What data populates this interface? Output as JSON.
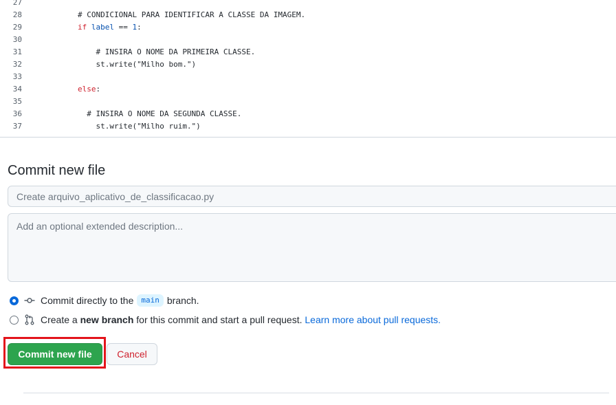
{
  "code": {
    "lines": [
      {
        "num": "27",
        "tokens": []
      },
      {
        "num": "28",
        "tokens": [
          {
            "t": "        ",
            "c": ""
          },
          {
            "t": "# CONDICIONAL PARA IDENTIFICAR A CLASSE DA IMAGEM.",
            "c": ""
          }
        ]
      },
      {
        "num": "29",
        "tokens": [
          {
            "t": "        ",
            "c": ""
          },
          {
            "t": "if",
            "c": "kw"
          },
          {
            "t": " ",
            "c": ""
          },
          {
            "t": "label",
            "c": "var"
          },
          {
            "t": " == ",
            "c": ""
          },
          {
            "t": "1",
            "c": "num"
          },
          {
            "t": ":",
            "c": ""
          }
        ]
      },
      {
        "num": "30",
        "tokens": []
      },
      {
        "num": "31",
        "tokens": [
          {
            "t": "            ",
            "c": ""
          },
          {
            "t": "# INSIRA O NOME DA PRIMEIRA CLASSE.",
            "c": ""
          }
        ]
      },
      {
        "num": "32",
        "tokens": [
          {
            "t": "            ",
            "c": ""
          },
          {
            "t": "st.write(\"Milho bom.\")",
            "c": ""
          }
        ]
      },
      {
        "num": "33",
        "tokens": []
      },
      {
        "num": "34",
        "tokens": [
          {
            "t": "        ",
            "c": ""
          },
          {
            "t": "else",
            "c": "kw"
          },
          {
            "t": ":",
            "c": ""
          }
        ]
      },
      {
        "num": "35",
        "tokens": []
      },
      {
        "num": "36",
        "tokens": [
          {
            "t": "          ",
            "c": ""
          },
          {
            "t": "# INSIRA O NOME DA SEGUNDA CLASSE.",
            "c": ""
          }
        ]
      },
      {
        "num": "37",
        "tokens": [
          {
            "t": "            ",
            "c": ""
          },
          {
            "t": "st.write(\"Milho ruim.\")",
            "c": ""
          }
        ]
      }
    ]
  },
  "commit": {
    "title": "Commit new file",
    "summary_placeholder": "Create arquivo_aplicativo_de_classificacao.py",
    "summary_value": "",
    "description_placeholder": "Add an optional extended description...",
    "description_value": "",
    "option_direct": {
      "prefix": "Commit directly to the",
      "branch": "main",
      "suffix": "branch.",
      "checked": true,
      "icon": "git-commit-icon"
    },
    "option_new_branch": {
      "prefix": "Create a",
      "bold": "new branch",
      "middle": "for this commit and start a pull request.",
      "link": "Learn more about pull requests.",
      "checked": false,
      "icon": "git-pull-request-icon"
    },
    "commit_button_label": "Commit new file",
    "cancel_button_label": "Cancel"
  },
  "colors": {
    "primary_button": "#2da44e",
    "cancel_text": "#cf222e",
    "link": "#0969da",
    "highlight_box": "#e3141b"
  }
}
